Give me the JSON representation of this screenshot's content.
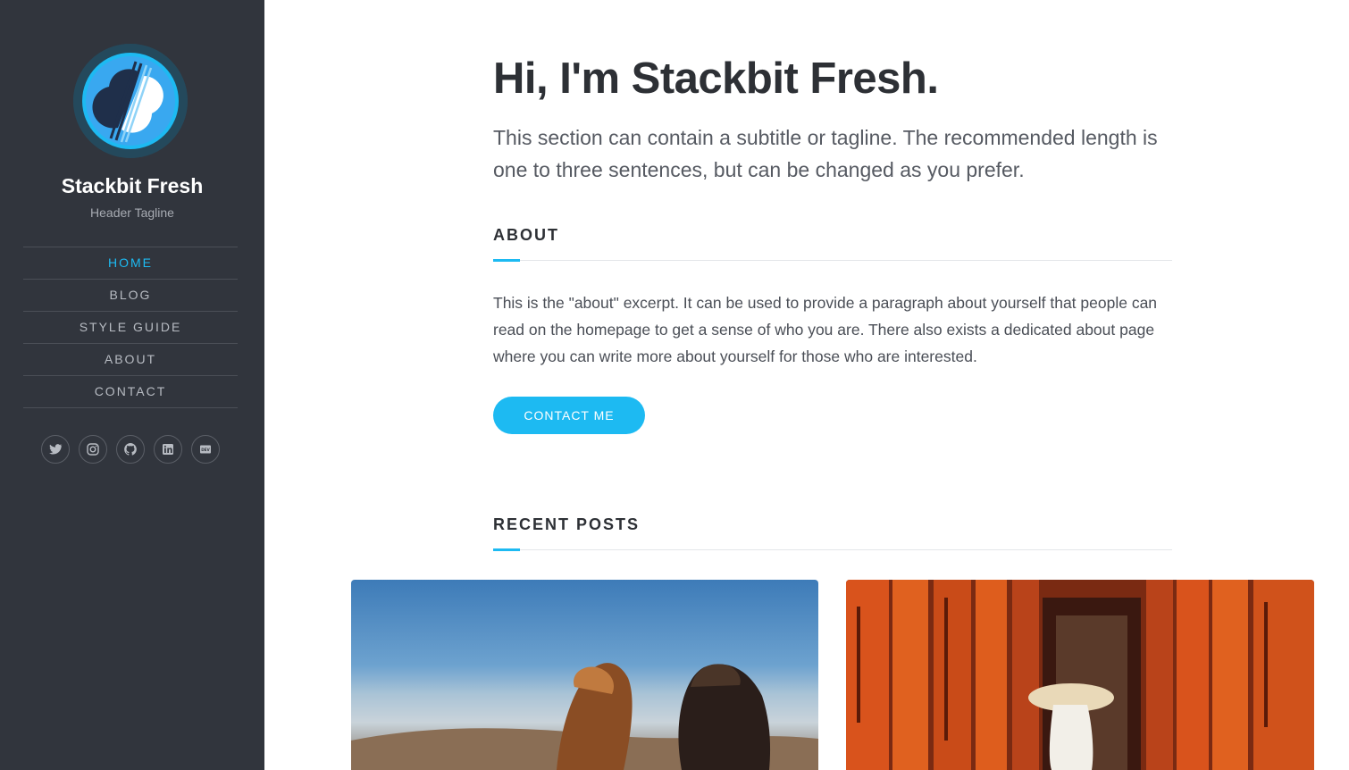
{
  "site": {
    "title": "Stackbit Fresh",
    "tagline": "Header Tagline"
  },
  "nav": [
    {
      "label": "HOME",
      "active": true
    },
    {
      "label": "BLOG",
      "active": false
    },
    {
      "label": "STYLE GUIDE",
      "active": false
    },
    {
      "label": "ABOUT",
      "active": false
    },
    {
      "label": "CONTACT",
      "active": false
    }
  ],
  "social": [
    "twitter-icon",
    "instagram-icon",
    "github-icon",
    "linkedin-icon",
    "dev-icon"
  ],
  "hero": {
    "title": "Hi, I'm Stackbit Fresh.",
    "subtitle": "This section can contain a subtitle or tagline. The recommended length is one to three sentences, but can be changed as you prefer."
  },
  "about": {
    "heading": "ABOUT",
    "text": "This is the \"about\" excerpt. It can be used to provide a paragraph about yourself that people can read on the homepage to get a sense of who you are. There also exists a dedicated about page where you can write more about yourself for those who are interested.",
    "button_label": "CONTACT ME"
  },
  "recent_posts": {
    "heading": "RECENT POSTS"
  },
  "colors": {
    "accent": "#1dbaf2",
    "sidebar_bg": "#31353d",
    "text_dark": "#2d3035"
  }
}
